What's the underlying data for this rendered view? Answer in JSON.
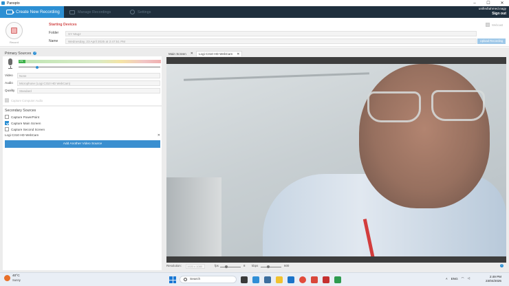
{
  "window": {
    "title": "Panopto",
    "minimize": "–",
    "maximize": "☐",
    "close": "✕"
  },
  "header": {
    "tabs": [
      {
        "label": "Create New Recording"
      },
      {
        "label": "Manage Recordings"
      },
      {
        "label": "Settings"
      }
    ],
    "user": "unified\\ahmed.nagy",
    "signout": "Sign out"
  },
  "session": {
    "record_label": "Record",
    "status": "Starting Devices",
    "folder_label": "Folder",
    "folder_value": "SY Magz",
    "name_label": "Name",
    "name_value": "Wednesday, 23 April 2025 at 2:47:51 PM",
    "record_checkbox": "Webcast",
    "save_button": "Upload Recording"
  },
  "primary_sources": {
    "title": "Primary Sources",
    "help": "?",
    "meter_level": 0.05,
    "meter_label": "1%",
    "audio_volume": 0.13,
    "video_label": "Video",
    "video_value": "None",
    "audio_label": "Audio",
    "audio_value": "Microphone (Logi C310 HD WebCam)",
    "quality_label": "Quality",
    "quality_value": "Standard",
    "capture_computer_audio": "Capture Computer Audio"
  },
  "secondary_sources": {
    "title": "Secondary Sources",
    "items": [
      {
        "label": "Capture PowerPoint",
        "checked": false
      },
      {
        "label": "Capture Main Screen",
        "checked": true
      },
      {
        "label": "Capture Second Screen",
        "checked": false
      }
    ],
    "webcam_source": "Logi C310 HD WebCam",
    "remove_icon": "✕",
    "add_button": "Add Another Video Source"
  },
  "preview": {
    "tabs": [
      {
        "label": "Main Screen",
        "close": "✕"
      },
      {
        "label": "Logi C310 HD WebCam",
        "close": "✕"
      }
    ],
    "resolution_label": "Resolution:",
    "resolution_value": "1920 x 1080",
    "fps_label": "fps",
    "fps_value": "8",
    "fps_level": 0.3,
    "kbps_label": "kbps",
    "kbps_value": "600",
    "kbps_level": 0.35,
    "help": "?"
  },
  "taskbar": {
    "temperature": "40°C",
    "condition": "Sunny",
    "search_placeholder": "Search",
    "language": "ENG",
    "time": "2:49 PM",
    "date": "23/04/2025"
  },
  "colors": {
    "header_bg": "#1f2f3d",
    "accent_blue": "#2c8fd3",
    "status_red": "#d24a4a"
  }
}
